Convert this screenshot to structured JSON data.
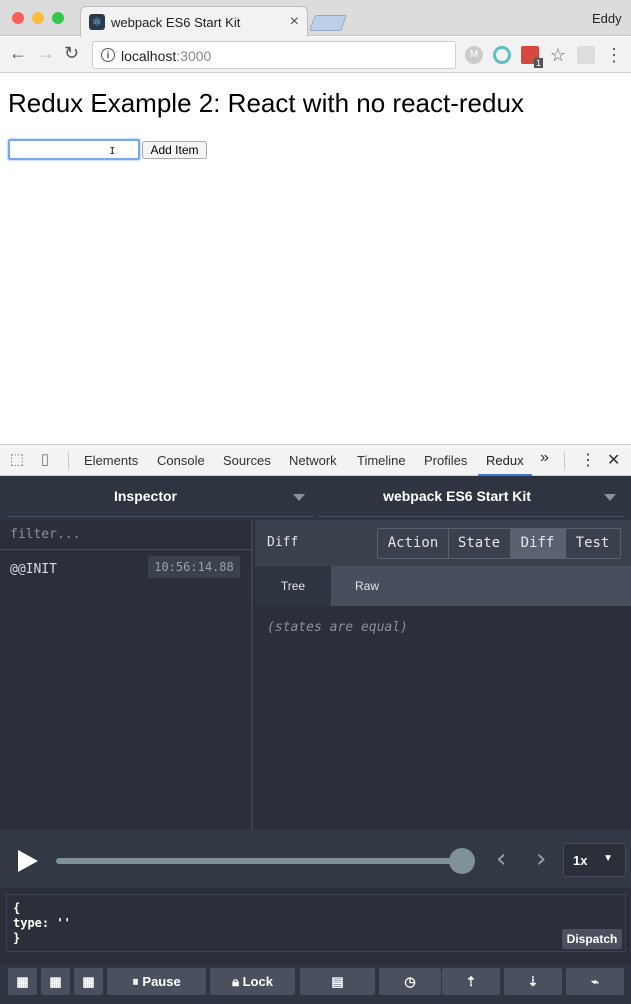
{
  "browser": {
    "tab_title": "webpack ES6 Start Kit",
    "profile_name": "Eddy",
    "url_host": "localhost",
    "url_port": ":3000",
    "close_glyph": "×",
    "ext_badge": "1"
  },
  "page": {
    "heading": "Redux Example 2: React with no react-redux",
    "input_value": "",
    "add_button": "Add Item"
  },
  "devtools": {
    "tabs": [
      "Elements",
      "Console",
      "Sources",
      "Network",
      "Timeline",
      "Profiles",
      "Redux"
    ],
    "active_tab": "Redux",
    "more": "»"
  },
  "redux": {
    "monitor": "Inspector",
    "instance": "webpack ES6 Start Kit",
    "filter_placeholder": "filter...",
    "actions": [
      {
        "name": "@@INIT",
        "time": "10:56:14.88"
      }
    ],
    "panel_title": "Diff",
    "tabs": [
      "Action",
      "State",
      "Diff",
      "Test"
    ],
    "active_tab": "Diff",
    "subtabs": [
      "Tree",
      "Raw"
    ],
    "active_subtab": "Tree",
    "diff_message": "(states are equal)",
    "slider_progress": 1.0,
    "speed": "1x",
    "dispatch_code": [
      "{",
      "type: ''",
      "}"
    ],
    "dispatch_button": "Dispatch",
    "bottom_buttons": {
      "pause": "Pause",
      "lock": "Lock"
    }
  },
  "colors": {
    "accent": "#3879d9",
    "panel_bg": "#2a2f3a"
  }
}
